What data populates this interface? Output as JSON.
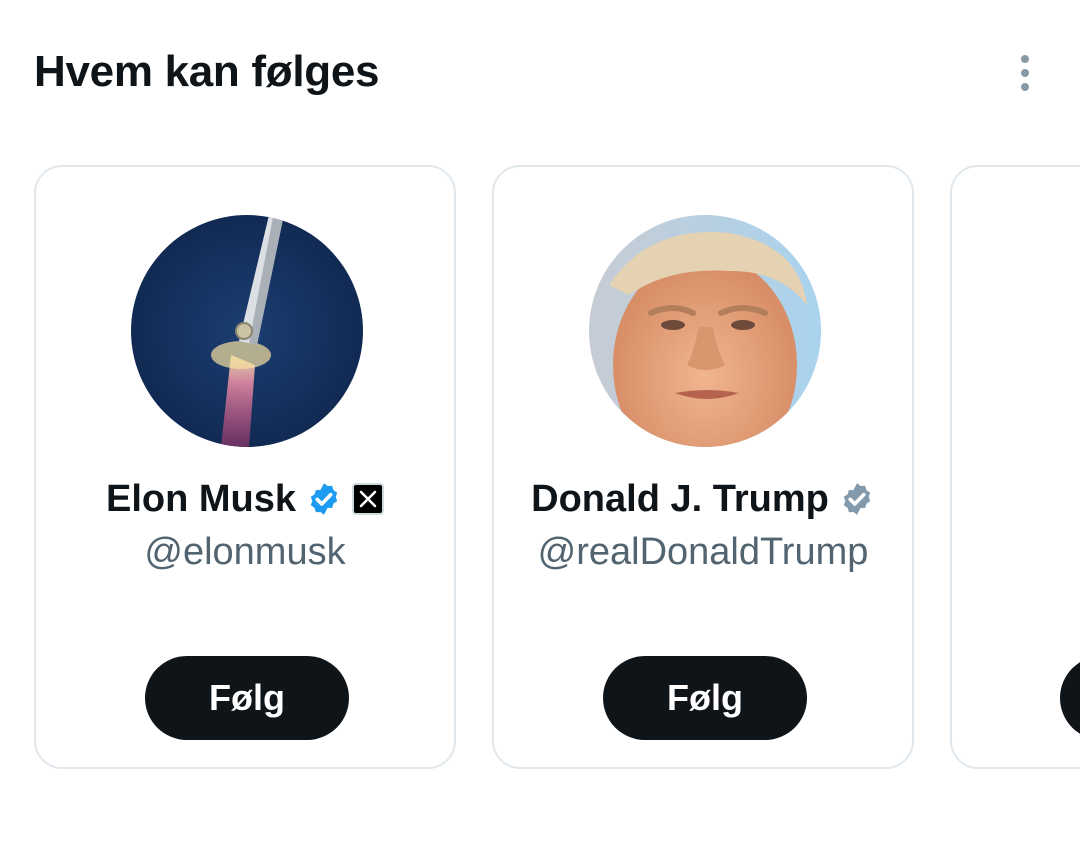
{
  "header": {
    "title": "Hvem kan følges"
  },
  "cards": [
    {
      "name": "Elon Musk",
      "handle": "@elonmusk",
      "verified_badge": "blue-verified-icon",
      "affiliation_badge": "x-logo-icon",
      "follow_label": "Følg"
    },
    {
      "name": "Donald J. Trump",
      "handle": "@realDonaldTrump",
      "verified_badge": "gray-verified-icon",
      "follow_label": "Følg"
    }
  ],
  "colors": {
    "text_primary": "#0f1419",
    "text_secondary": "#536471",
    "verified_blue": "#1d9bf0",
    "verified_gray": "#829aab",
    "button_bg": "#0f1419",
    "card_border": "#e1e8ed"
  }
}
